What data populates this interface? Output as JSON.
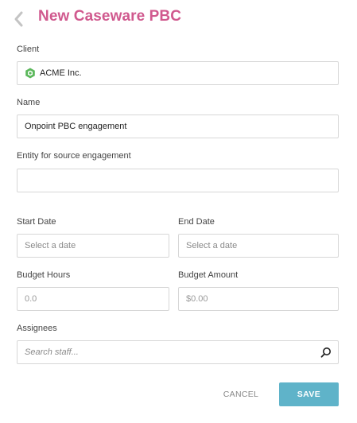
{
  "header": {
    "title": "New Caseware PBC"
  },
  "form": {
    "client": {
      "label": "Client",
      "value": "ACME Inc.",
      "icon": "hexagon-icon",
      "icon_color": "#5cb85c"
    },
    "name": {
      "label": "Name",
      "value": "Onpoint PBC engagement"
    },
    "entity": {
      "label": "Entity for source engagement",
      "value": ""
    },
    "start_date": {
      "label": "Start Date",
      "placeholder": "Select a date"
    },
    "end_date": {
      "label": "End Date",
      "placeholder": "Select a date"
    },
    "budget_hours": {
      "label": "Budget Hours",
      "placeholder": "0.0"
    },
    "budget_amount": {
      "label": "Budget Amount",
      "placeholder": "$0.00"
    },
    "assignees": {
      "label": "Assignees",
      "placeholder": "Search staff..."
    }
  },
  "actions": {
    "cancel_label": "CANCEL",
    "save_label": "SAVE",
    "save_color": "#5fb3c9"
  },
  "colors": {
    "title": "#d0598e",
    "accent": "#5fb3c9"
  }
}
